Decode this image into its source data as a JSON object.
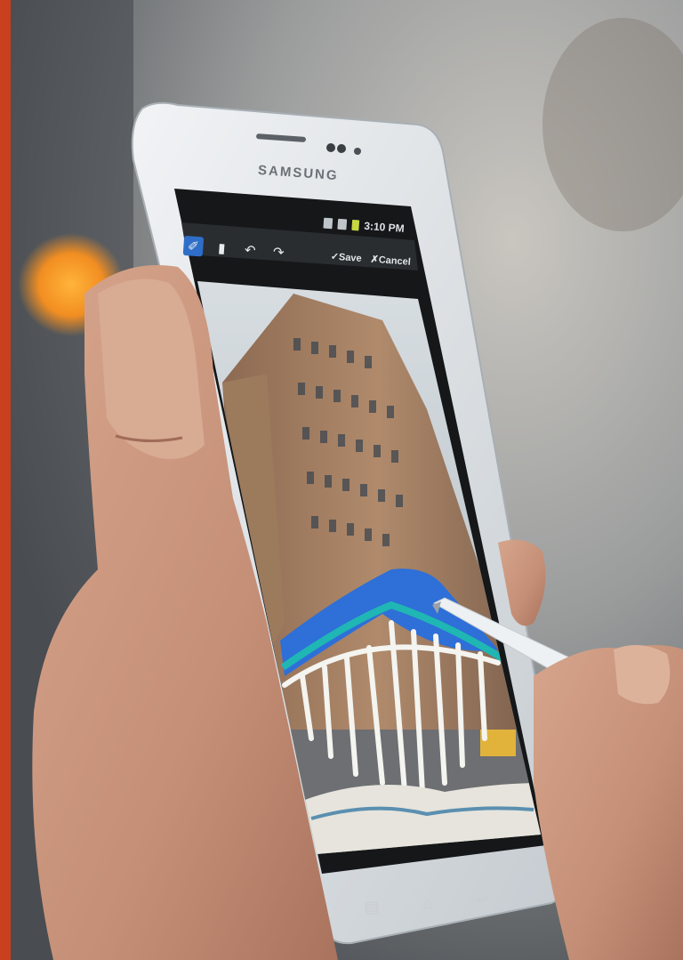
{
  "phone": {
    "brand": "SAMSUNG",
    "status_bar": {
      "time": "3:10 PM"
    },
    "toolbar": {
      "tools": [
        {
          "icon": "pen-icon",
          "glyph": "✐",
          "active": true
        },
        {
          "icon": "eraser-icon",
          "glyph": "▮",
          "active": false
        },
        {
          "icon": "undo-icon",
          "glyph": "↶",
          "active": false
        },
        {
          "icon": "redo-icon",
          "glyph": "↷",
          "active": false
        }
      ],
      "save_label": "✓Save",
      "cancel_label": "✗Cancel"
    },
    "nav_keys": [
      {
        "icon": "menu-icon",
        "glyph": "▤"
      },
      {
        "icon": "home-icon",
        "glyph": "⌂"
      },
      {
        "icon": "back-icon",
        "glyph": "↩"
      },
      {
        "icon": "search-icon",
        "glyph": "⌕"
      }
    ]
  },
  "colors": {
    "drawing_blue": "#2e6fd8",
    "drawing_teal": "#1fb6b4",
    "drawing_white": "#f4f4f0",
    "accent_orange": "#f29a2e"
  }
}
